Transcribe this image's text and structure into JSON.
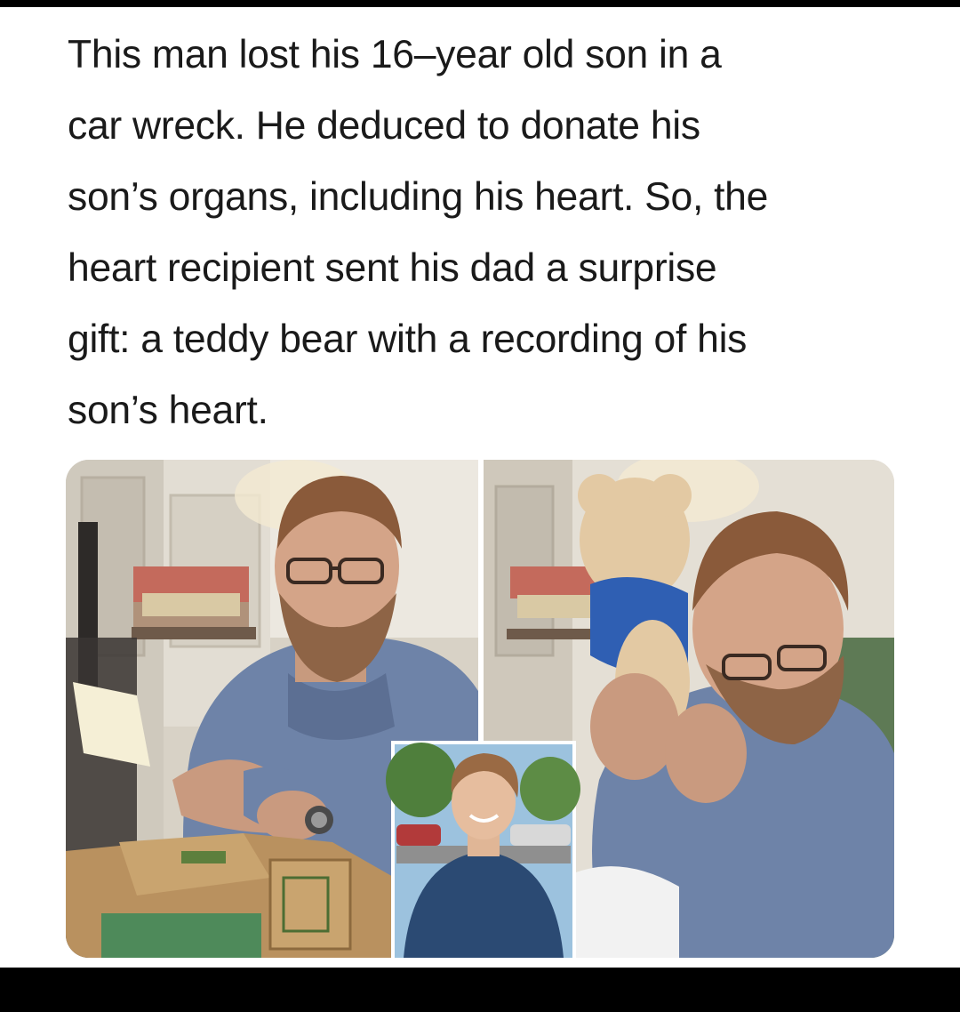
{
  "post": {
    "caption_lines": [
      "This man lost his 16–year old son in a",
      "car wreck. He deduced to donate his",
      "son’s organs, including his heart. So, the",
      "heart recipient sent his dad a surprise",
      "gift: a teddy bear with a recording of his",
      "son’s heart."
    ]
  },
  "colors": {
    "background": "#ffffff",
    "text": "#1a1a1a",
    "frame": "#000000"
  }
}
